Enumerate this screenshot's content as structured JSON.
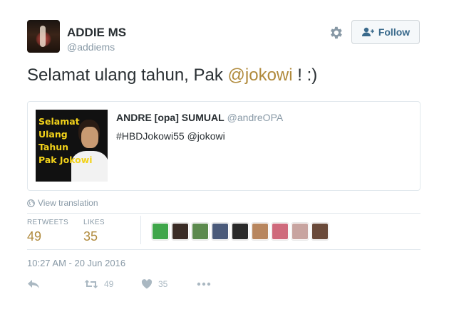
{
  "author": {
    "name": "ADDIE MS",
    "handle": "@addiems"
  },
  "follow_button": {
    "label": "Follow"
  },
  "tweet": {
    "text_before": "Selamat ulang tahun, Pak ",
    "mention": "@jokowi",
    "text_after": " ! :)"
  },
  "quoted_tweet": {
    "image_text": [
      "Selamat",
      "Ulang",
      "Tahun",
      "Pak Jokowi"
    ],
    "name": "ANDRE [opa] SUMUAL",
    "handle": "@andreOPA",
    "text": "#HBDJokowi55 @jokowi"
  },
  "view_translation": "View translation",
  "stats": {
    "retweets_label": "RETWEETS",
    "retweets_value": "49",
    "likes_label": "LIKES",
    "likes_value": "35"
  },
  "likers_avatar_colors": [
    "#3fa64a",
    "#3a2c26",
    "#5c8a4e",
    "#4a5a7a",
    "#2a2a2a",
    "#b8865e",
    "#cf6a7c",
    "#c8a4a0",
    "#6a4a3a"
  ],
  "timestamp": "10:27 AM - 20 Jun 2016",
  "actions": {
    "retweet_count": "49",
    "like_count": "35"
  },
  "colors": {
    "link": "#b08a3c",
    "muted": "#8899a6",
    "follow_text": "#3a6a8c"
  }
}
